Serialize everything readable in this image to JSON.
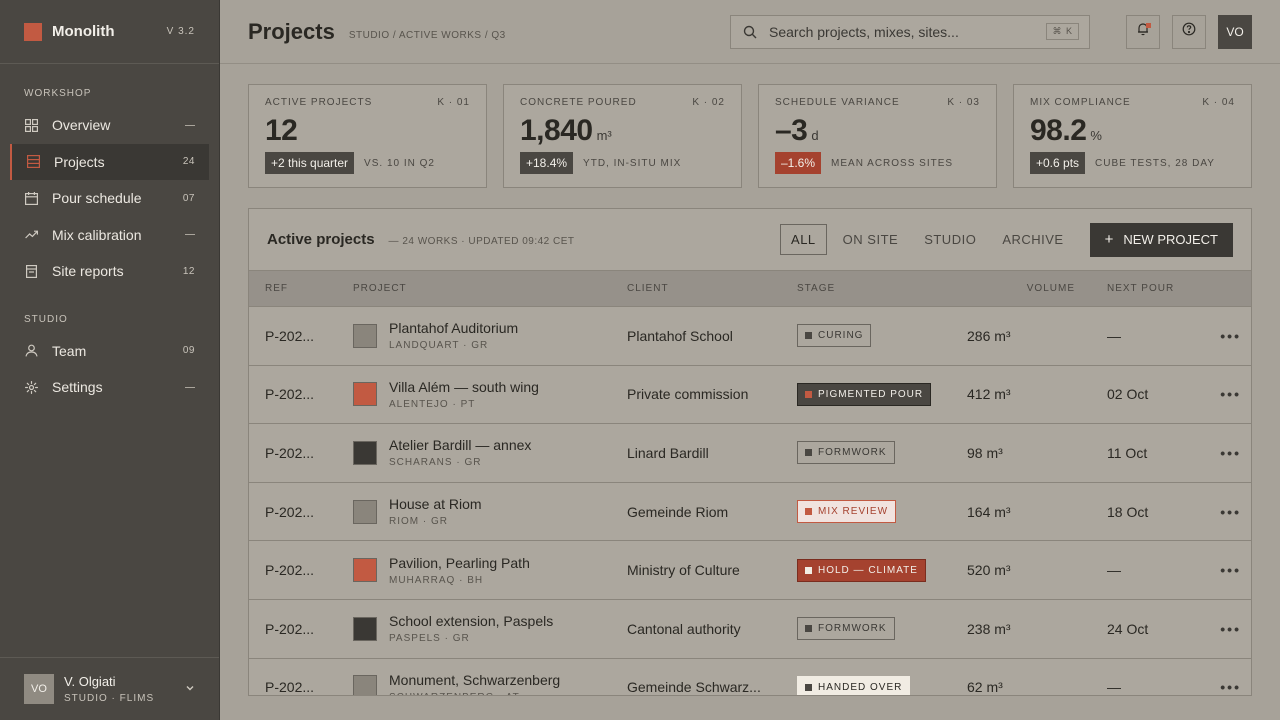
{
  "brand": {
    "name": "Monolith",
    "version": "V 3.2"
  },
  "sidebar": {
    "sections": [
      {
        "label": "WORKSHOP"
      },
      {
        "label": "STUDIO"
      }
    ],
    "items": [
      {
        "label": "Overview",
        "count": "",
        "icon": "grid-icon"
      },
      {
        "label": "Projects",
        "count": "24",
        "icon": "list-icon"
      },
      {
        "label": "Pour schedule",
        "count": "07",
        "icon": "calendar-icon"
      },
      {
        "label": "Mix calibration",
        "count": "",
        "icon": "trend-icon"
      },
      {
        "label": "Site reports",
        "count": "12",
        "icon": "report-icon"
      },
      {
        "label": "Team",
        "count": "09",
        "icon": "user-icon"
      },
      {
        "label": "Settings",
        "count": "",
        "icon": "gear-icon"
      }
    ]
  },
  "user": {
    "initials": "VO",
    "name": "V. Olgiati",
    "meta": "STUDIO · FLIMS"
  },
  "header": {
    "title": "Projects",
    "breadcrumb": "STUDIO / ACTIVE WORKS / Q3",
    "search_placeholder": "Search projects, mixes, sites...",
    "shortcut": "⌘ K",
    "avatar": "VO"
  },
  "kpis": [
    {
      "label": "ACTIVE PROJECTS",
      "code": "K · 01",
      "value": "12",
      "unit": "",
      "delta": "+2 this quarter",
      "delta_type": "pos",
      "note": "VS. 10 IN Q2"
    },
    {
      "label": "CONCRETE POURED",
      "code": "K · 02",
      "value": "1,840",
      "unit": "m³",
      "delta": "+18.4%",
      "delta_type": "pos",
      "note": "YTD, IN-SITU MIX"
    },
    {
      "label": "SCHEDULE VARIANCE",
      "code": "K · 03",
      "value": "–3",
      "unit": "d",
      "delta": "–1.6%",
      "delta_type": "neg",
      "note": "MEAN ACROSS SITES"
    },
    {
      "label": "MIX COMPLIANCE",
      "code": "K · 04",
      "value": "98.2",
      "unit": "%",
      "delta": "+0.6 pts",
      "delta_type": "pos",
      "note": "CUBE TESTS, 28 DAY"
    }
  ],
  "table": {
    "title": "Active projects",
    "subtitle": "— 24 WORKS · UPDATED 09:42 CET",
    "filters": [
      "ALL",
      "ON SITE",
      "STUDIO",
      "ARCHIVE"
    ],
    "new_button": "NEW PROJECT",
    "columns": [
      "REF",
      "PROJECT",
      "CLIENT",
      "STAGE",
      "VOLUME",
      "NEXT POUR"
    ],
    "rows": [
      {
        "ref": "P-202...",
        "name": "Plantahof Auditorium",
        "location": "LANDQUART · GR",
        "swatch": "#8a857c",
        "client": "Plantahof School",
        "stage": "CURING",
        "stage_style": "outline",
        "volume": "286 m³",
        "next": "—"
      },
      {
        "ref": "P-202...",
        "name": "Villa Além — south wing",
        "location": "ALENTEJO · PT",
        "swatch": "#c25a42",
        "client": "Private commission",
        "stage": "PIGMENTED POUR",
        "stage_style": "dark",
        "volume": "412 m³",
        "next": "02 Oct"
      },
      {
        "ref": "P-202...",
        "name": "Atelier Bardill — annex",
        "location": "SCHARANS · GR",
        "swatch": "#3a3834",
        "client": "Linard Bardill",
        "stage": "FORMWORK",
        "stage_style": "outline",
        "volume": "98 m³",
        "next": "11 Oct"
      },
      {
        "ref": "P-202...",
        "name": "House at Riom",
        "location": "RIOM · GR",
        "swatch": "#8a857c",
        "client": "Gemeinde Riom",
        "stage": "MIX REVIEW",
        "stage_style": "alert",
        "volume": "164 m³",
        "next": "18 Oct"
      },
      {
        "ref": "P-202...",
        "name": "Pavilion, Pearling Path",
        "location": "MUHARRAQ · BH",
        "swatch": "#c25a42",
        "client": "Ministry of Culture",
        "stage": "HOLD — CLIMATE",
        "stage_style": "danger",
        "volume": "520 m³",
        "next": "—"
      },
      {
        "ref": "P-202...",
        "name": "School extension, Paspels",
        "location": "PASPELS · GR",
        "swatch": "#3a3834",
        "client": "Cantonal authority",
        "stage": "FORMWORK",
        "stage_style": "outline",
        "volume": "238 m³",
        "next": "24 Oct"
      },
      {
        "ref": "P-202...",
        "name": "Monument, Schwarzenberg",
        "location": "SCHWARZENBERG · AT",
        "swatch": "#8a857c",
        "client": "Gemeinde Schwarz...",
        "stage": "HANDED OVER",
        "stage_style": "light",
        "volume": "62 m³",
        "next": "—"
      }
    ]
  },
  "colors": {
    "accent": "#c25a42",
    "sidebar": "#4a4742",
    "surface": "#a7a299"
  }
}
